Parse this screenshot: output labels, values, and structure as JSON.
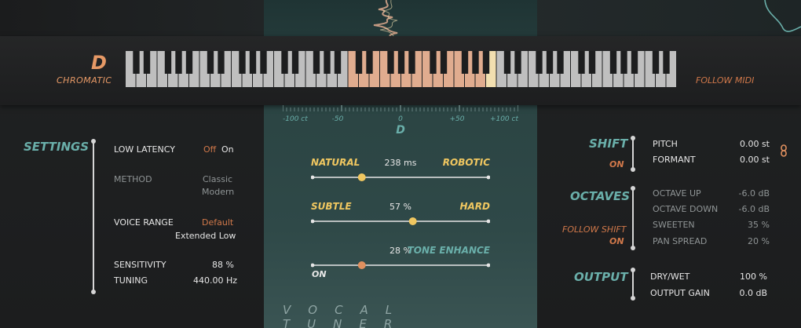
{
  "header": {
    "key": "D",
    "scale": "CHROMATIC",
    "follow_midi": "FOLLOW MIDI"
  },
  "keyboard": {
    "white_keys": 52,
    "active_keys": [
      21,
      22,
      23,
      24,
      25,
      26,
      27,
      28,
      29,
      30,
      31,
      32,
      33,
      34
    ],
    "active_color": "#e0ac8f",
    "root_color": "#f2dfb0",
    "inactive_color": "#bfbfbf"
  },
  "meter": {
    "left_label": "-100 ct",
    "l50": "-50",
    "zero": "0",
    "r50": "+50",
    "right_label": "+100 ct",
    "note": "D"
  },
  "center": {
    "s1": {
      "left": "NATURAL",
      "right": "ROBOTIC",
      "value": "238 ms",
      "position": 0.28
    },
    "s2": {
      "left": "SUBTLE",
      "right": "HARD",
      "value": "57 %",
      "position": 0.57
    },
    "s3": {
      "right": "TONE ENHANCE",
      "value": "28 %",
      "on": "ON",
      "position": 0.28
    }
  },
  "settings": {
    "title": "SETTINGS",
    "low_latency": {
      "label": "LOW LATENCY",
      "off": "Off",
      "on": "On"
    },
    "method": {
      "label": "METHOD",
      "opt1": "Classic",
      "opt2": "Modern"
    },
    "voice_range": {
      "label": "VOICE RANGE",
      "opt1": "Default",
      "opt2": "Extended Low"
    },
    "sensitivity": {
      "label": "SENSITIVITY",
      "value": "88 %"
    },
    "tuning": {
      "label": "TUNING",
      "value": "440.00 Hz"
    }
  },
  "shift": {
    "title": "SHIFT",
    "on": "ON",
    "pitch_label": "PITCH",
    "pitch_value": "0.00 st",
    "formant_label": "FORMANT",
    "formant_value": "0.00 st"
  },
  "octaves": {
    "title": "OCTAVES",
    "follow_shift": "FOLLOW SHIFT",
    "on": "ON",
    "up_label": "OCTAVE UP",
    "up_value": "-6.0 dB",
    "down_label": "OCTAVE DOWN",
    "down_value": "-6.0 dB",
    "sweeten_label": "SWEETEN",
    "sweeten_value": "35 %",
    "pan_label": "PAN SPREAD",
    "pan_value": "20 %"
  },
  "output": {
    "title": "OUTPUT",
    "drywet_label": "DRY/WET",
    "drywet_value": "100 %",
    "gain_label": "OUTPUT GAIN",
    "gain_value": "0.0 dB"
  },
  "footer": {
    "brand": "VOCAL TUNER"
  }
}
